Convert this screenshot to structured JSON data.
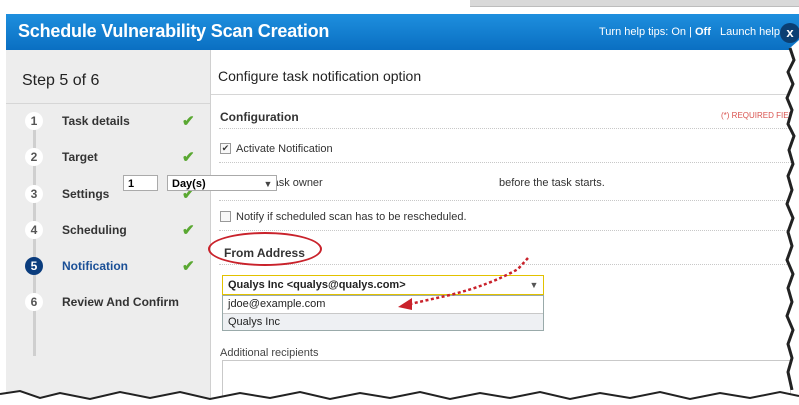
{
  "header": {
    "title": "Schedule Vulnerability Scan Creation",
    "help_prefix": "Turn help tips: On | ",
    "help_off": "Off",
    "launch_help": "Launch help",
    "close": "x"
  },
  "sidebar": {
    "step_title": "Step 5 of 6",
    "steps": [
      {
        "num": "1",
        "label": "Task details",
        "done": true
      },
      {
        "num": "2",
        "label": "Target",
        "done": true
      },
      {
        "num": "3",
        "label": "Settings",
        "done": true
      },
      {
        "num": "4",
        "label": "Scheduling",
        "done": true
      },
      {
        "num": "5",
        "label": "Notification",
        "done": true,
        "active": true
      },
      {
        "num": "6",
        "label": "Review And Confirm",
        "done": false
      }
    ]
  },
  "main": {
    "heading": "Configure task notification option",
    "configuration": "Configuration",
    "required": "(*) REQUIRED FIELD",
    "activate_label": "Activate Notification",
    "notify_prefix": "Notify the task owner",
    "notify_number": "1",
    "notify_unit": "Day(s)",
    "notify_suffix": "before the task starts.",
    "reschedule_label": "Notify if scheduled scan has to be rescheduled.",
    "from_address": "From Address",
    "from_selected": "Qualys Inc <qualys@qualys.com>",
    "from_options": [
      "jdoe@example.com",
      "Qualys Inc"
    ],
    "additional_recipients": "Additional recipients"
  },
  "colors": {
    "header": "#0a6fc2",
    "annotation": "#c9222b",
    "check": "#5aa832",
    "active_step": "#0a3c7d"
  }
}
